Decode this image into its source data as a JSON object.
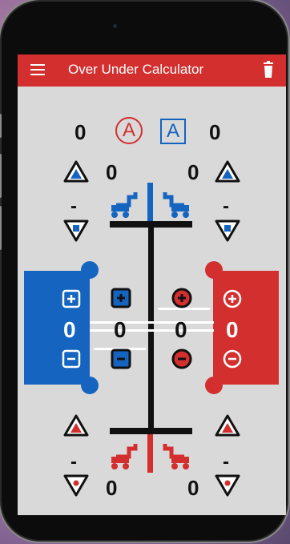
{
  "app": {
    "title": "Over Under Calculator"
  },
  "header": {
    "score_red": "0",
    "score_blue": "0",
    "letter_red": "A",
    "letter_blue": "A"
  },
  "blue_top": {
    "left_count": "0",
    "dash": "-"
  },
  "red_top": {
    "right_count": "0",
    "dash": "-"
  },
  "middle": {
    "blue_total": "0",
    "blue_inner": "0",
    "red_inner": "0",
    "red_total": "0"
  },
  "red_bottom": {
    "left_count": "0",
    "dash": "-"
  },
  "blue_bottom": {
    "right_count": "0",
    "dash": "-"
  },
  "colors": {
    "red": "#d32f2f",
    "blue": "#1565c0",
    "background": "#d9d9d9",
    "dark": "#111111"
  },
  "icons": [
    "menu-icon",
    "trash-icon",
    "triangle-up-icon",
    "triangle-down-icon",
    "plus-icon",
    "minus-icon",
    "robot-icon"
  ]
}
